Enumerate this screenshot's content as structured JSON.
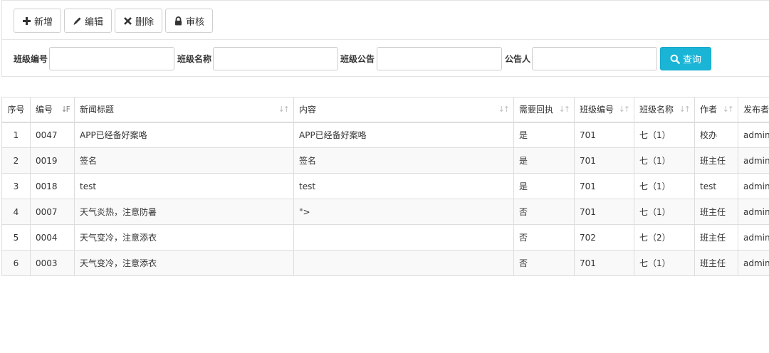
{
  "toolbar": {
    "add_label": "新增",
    "edit_label": "编辑",
    "delete_label": "删除",
    "audit_label": "审核"
  },
  "search": {
    "class_no_label": "班级编号",
    "class_name_label": "班级名称",
    "notice_label": "班级公告",
    "publisher_label": "公告人",
    "button_label": "查询"
  },
  "table": {
    "headers": [
      "序号",
      "编号",
      "新闻标题",
      "内容",
      "需要回执",
      "班级编号",
      "班级名称",
      "作者",
      "发布者"
    ],
    "rows": [
      [
        "1",
        "0047",
        "APP已经备好案咯",
        "APP已经备好案咯",
        "是",
        "701",
        "七（1）",
        "校办",
        "admin"
      ],
      [
        "2",
        "0019",
        "签名",
        "签名",
        "是",
        "701",
        "七（1）",
        "班主任",
        "admin"
      ],
      [
        "3",
        "0018",
        "test",
        "test",
        "是",
        "701",
        "七（1）",
        "test",
        "admin"
      ],
      [
        "4",
        "0007",
        "天气炎热，注意防暑",
        "\">",
        "否",
        "701",
        "七（1）",
        "班主任",
        "admin"
      ],
      [
        "5",
        "0004",
        "天气变冷，注意添衣",
        "",
        "否",
        "702",
        "七（2）",
        "班主任",
        "admin"
      ],
      [
        "6",
        "0003",
        "天气变冷，注意添衣",
        "",
        "否",
        "701",
        "七（1）",
        "班主任",
        "admin"
      ]
    ]
  },
  "icons": {
    "add": "plus-icon",
    "edit": "pencil-icon",
    "delete": "times-icon",
    "audit": "lock-icon",
    "search": "search-icon",
    "sort": "sort-icon"
  },
  "colors": {
    "search_button": "#1ab5d6",
    "border": "#dddddd"
  }
}
